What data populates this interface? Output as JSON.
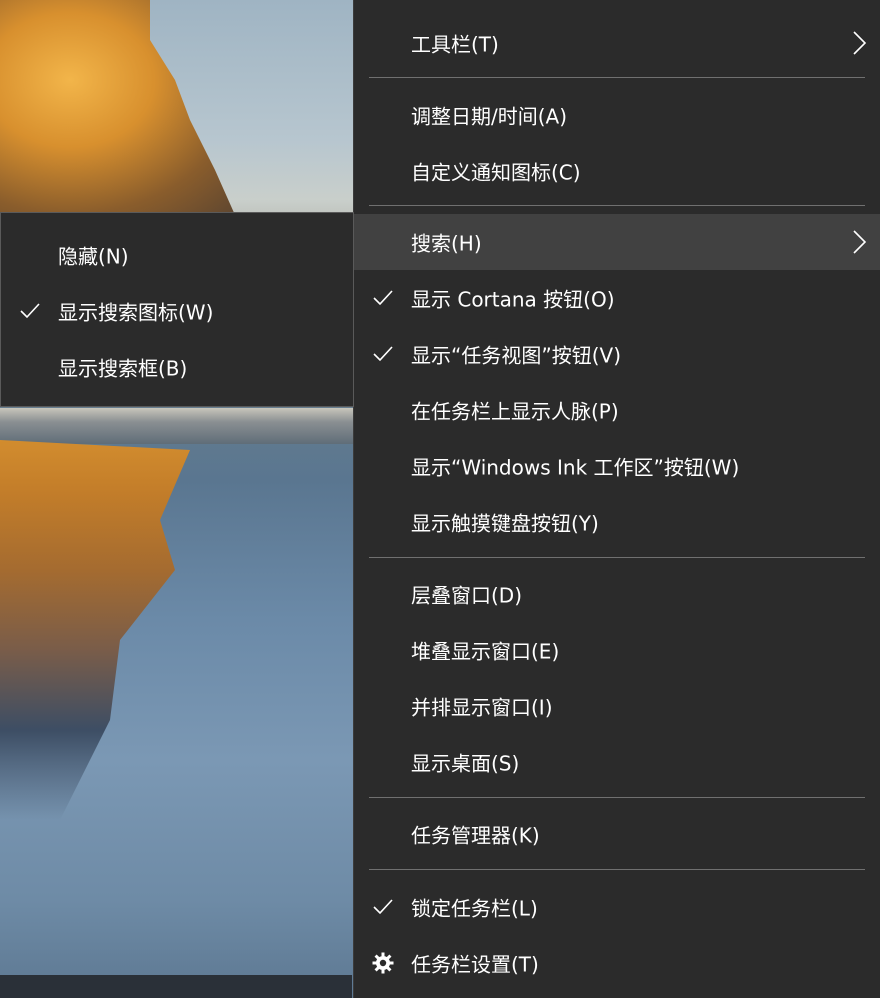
{
  "main_menu": {
    "items": [
      {
        "label": "工具栏(T)",
        "has_submenu": true
      },
      {
        "label": "调整日期/时间(A)"
      },
      {
        "label": "自定义通知图标(C)"
      },
      {
        "label": "搜索(H)",
        "has_submenu": true,
        "highlighted": true
      },
      {
        "label": "显示 Cortana 按钮(O)",
        "checked": true
      },
      {
        "label": "显示“任务视图”按钮(V)",
        "checked": true
      },
      {
        "label": "在任务栏上显示人脉(P)"
      },
      {
        "label": "显示“Windows Ink 工作区”按钮(W)"
      },
      {
        "label": "显示触摸键盘按钮(Y)"
      },
      {
        "label": "层叠窗口(D)"
      },
      {
        "label": "堆叠显示窗口(E)"
      },
      {
        "label": "并排显示窗口(I)"
      },
      {
        "label": "显示桌面(S)"
      },
      {
        "label": "任务管理器(K)"
      },
      {
        "label": "锁定任务栏(L)",
        "checked": true
      },
      {
        "label": "任务栏设置(T)",
        "icon": "gear-icon"
      }
    ]
  },
  "sub_menu": {
    "items": [
      {
        "label": "隐藏(N)"
      },
      {
        "label": "显示搜索图标(W)",
        "checked": true
      },
      {
        "label": "显示搜索框(B)"
      }
    ]
  },
  "colors": {
    "menu_bg": "#2b2b2b",
    "highlight_bg": "#414141",
    "separator": "#707070",
    "text": "#ffffff"
  }
}
